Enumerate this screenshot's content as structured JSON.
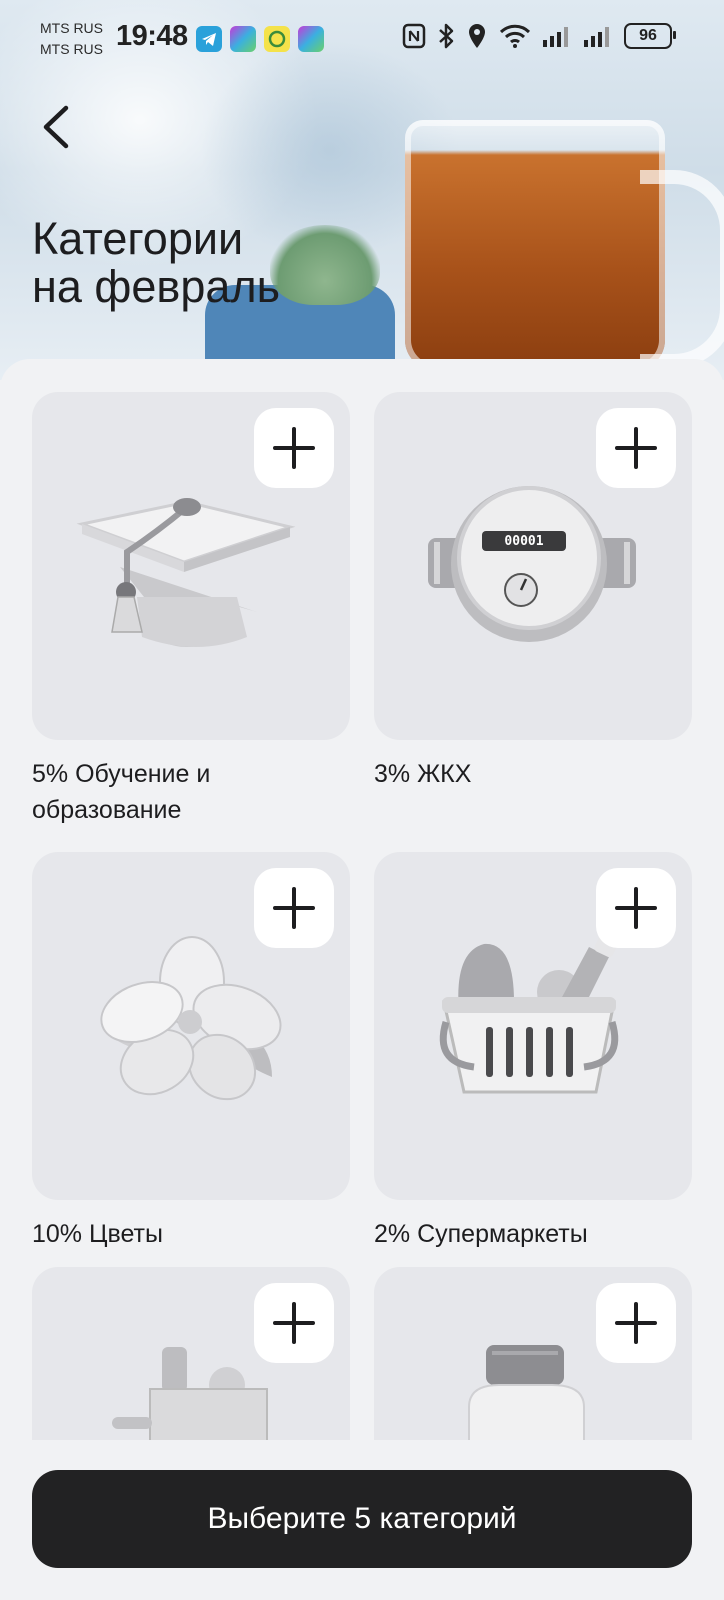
{
  "status_bar": {
    "carrier_1": "MTS RUS",
    "carrier_2": "MTS RUS",
    "time": "19:48",
    "battery": "96",
    "app_icons": [
      "telegram-icon",
      "game-app-icon",
      "c-app-icon",
      "game-app-icon"
    ],
    "system_icons": [
      "nfc-icon",
      "bluetooth-icon",
      "location-icon",
      "wifi-icon",
      "signal-icon",
      "signal-icon",
      "battery-icon"
    ]
  },
  "header": {
    "back_icon": "chevron-left-icon",
    "title_line1": "Категории",
    "title_line2": "на февраль"
  },
  "categories": [
    {
      "label": "5% Обучение и образование",
      "icon": "graduation-cap-icon"
    },
    {
      "label": "3% ЖКХ",
      "icon": "water-meter-icon",
      "meter_digits": "00001"
    },
    {
      "label": "10% Цветы",
      "icon": "flower-icon"
    },
    {
      "label": "2% Супермаркеты",
      "icon": "grocery-basket-icon"
    },
    {
      "label": "",
      "icon": "shopping-bag-icon"
    },
    {
      "label": "",
      "icon": "pill-bottle-icon"
    }
  ],
  "cta": {
    "label": "Выберите 5 категорий"
  },
  "colors": {
    "background": "#f1f2f4",
    "tile": "#e6e7eb",
    "cta_bg": "#222223",
    "cta_text": "#ffffff"
  }
}
